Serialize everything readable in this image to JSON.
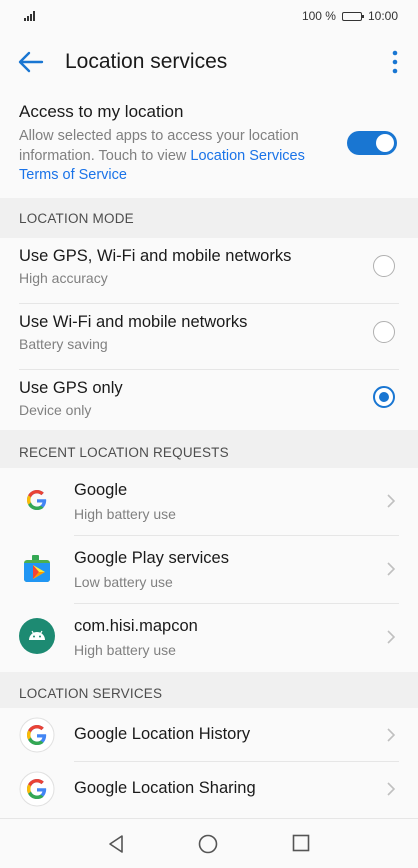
{
  "status_bar": {
    "battery_percent": "100 %",
    "time": "10:00"
  },
  "header": {
    "title": "Location services"
  },
  "access": {
    "title": "Access to my location",
    "description": "Allow selected apps to access your location information. Touch to view ",
    "link": "Location Services Terms of Service",
    "enabled": true
  },
  "location_mode": {
    "header": "LOCATION MODE",
    "options": [
      {
        "title": "Use GPS, Wi-Fi and mobile networks",
        "subtitle": "High accuracy",
        "selected": false
      },
      {
        "title": "Use Wi-Fi and mobile networks",
        "subtitle": "Battery saving",
        "selected": false
      },
      {
        "title": "Use GPS only",
        "subtitle": "Device only",
        "selected": true
      }
    ]
  },
  "recent_requests": {
    "header": "RECENT LOCATION REQUESTS",
    "apps": [
      {
        "name": "Google",
        "usage": "High battery use",
        "icon": "google-g-icon"
      },
      {
        "name": "Google Play services",
        "usage": "Low battery use",
        "icon": "play-services-icon"
      },
      {
        "name": "com.hisi.mapcon",
        "usage": "High battery use",
        "icon": "android-icon"
      }
    ]
  },
  "location_services": {
    "header": "LOCATION SERVICES",
    "items": [
      {
        "name": "Google Location History",
        "icon": "google-g-icon"
      },
      {
        "name": "Google Location Sharing",
        "icon": "google-g-icon"
      }
    ]
  },
  "colors": {
    "accent": "#1976d2",
    "link": "#1a73e8"
  }
}
